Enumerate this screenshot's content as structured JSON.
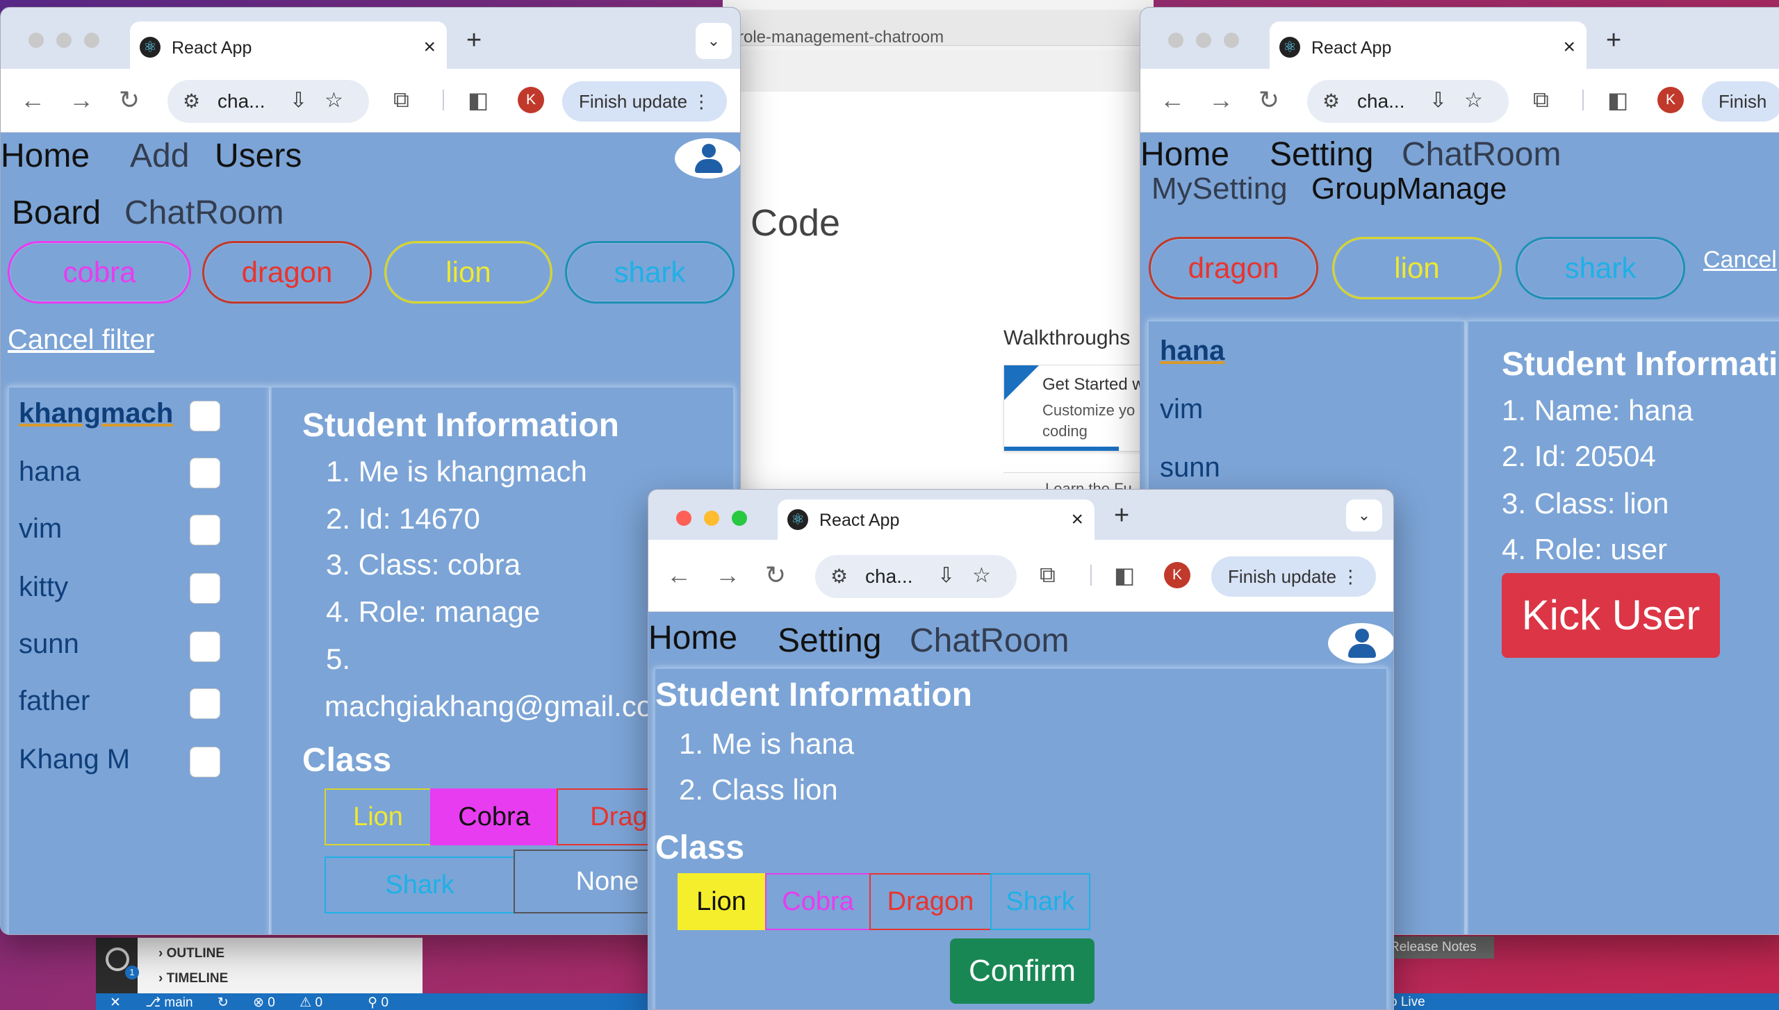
{
  "vscode": {
    "address": "role-management-chatroom",
    "code_label": "Code",
    "walkthroughs": "Walkthroughs",
    "card_title": "Get Started w",
    "card_desc_1": "Customize yo",
    "card_desc_2": "coding",
    "learn": "Learn the Fu",
    "outline": "OUTLINE",
    "timeline": "TIMELINE",
    "badge": "1",
    "status_branch": "main",
    "status_errors": "0",
    "status_warnings": "0",
    "status_ports": "0",
    "release_notes": "Release Notes",
    "status_right": "o Live"
  },
  "left": {
    "tab_title": "React App",
    "url": "cha...",
    "avatar": "K",
    "finish": "Finish update",
    "nav": {
      "home": "Home",
      "add": "Add",
      "users": "Users",
      "board": "Board",
      "chatroom": "ChatRoom"
    },
    "pills": [
      {
        "label": "cobra",
        "color": "#e83cf0"
      },
      {
        "label": "dragon",
        "color": "#e8342e"
      },
      {
        "label": "lion",
        "color": "#f0e830"
      },
      {
        "label": "shark",
        "color": "#1fb0e6"
      }
    ],
    "cancel": "Cancel filter",
    "users": [
      "khangmach",
      "hana",
      "vim",
      "kitty",
      "sunn",
      "father",
      "Khang M"
    ],
    "info_heading": "Student Information",
    "info": [
      "1. Me is  khangmach",
      "2. Id: 14670",
      "3. Class: cobra",
      "4. Role: manage",
      "5.",
      "machgiakhang@gmail.co"
    ],
    "class_heading": "Class",
    "classes": [
      "Lion",
      "Cobra",
      "Drago",
      "Shark",
      "None"
    ]
  },
  "right": {
    "tab_title": "React App",
    "url": "cha...",
    "avatar": "K",
    "finish": "Finish",
    "nav": {
      "home": "Home",
      "setting": "Setting",
      "chatroom": "ChatRoom",
      "mysetting": "MySetting",
      "groupmanage": "GroupManage"
    },
    "pills": [
      {
        "label": "dragon",
        "color": "#e8342e"
      },
      {
        "label": "lion",
        "color": "#f0e830"
      },
      {
        "label": "shark",
        "color": "#1fb0e6"
      }
    ],
    "cancel": "Cancel",
    "users": [
      "hana",
      "vim",
      "sunn"
    ],
    "info_heading": "Student Informati",
    "info": [
      "1. Name: hana",
      "2. Id: 20504",
      "3. Class: lion",
      "4. Role: user"
    ],
    "kick": "Kick User"
  },
  "middle": {
    "tab_title": "React App",
    "url": "cha...",
    "avatar": "K",
    "finish": "Finish update",
    "nav": {
      "home": "Home",
      "setting": "Setting",
      "chatroom": "ChatRoom"
    },
    "info_heading": "Student Information",
    "info": [
      "1. Me is  hana",
      "2. Class lion"
    ],
    "class_heading": "Class",
    "classes": [
      "Lion",
      "Cobra",
      "Dragon",
      "Shark"
    ],
    "confirm": "Confirm"
  }
}
